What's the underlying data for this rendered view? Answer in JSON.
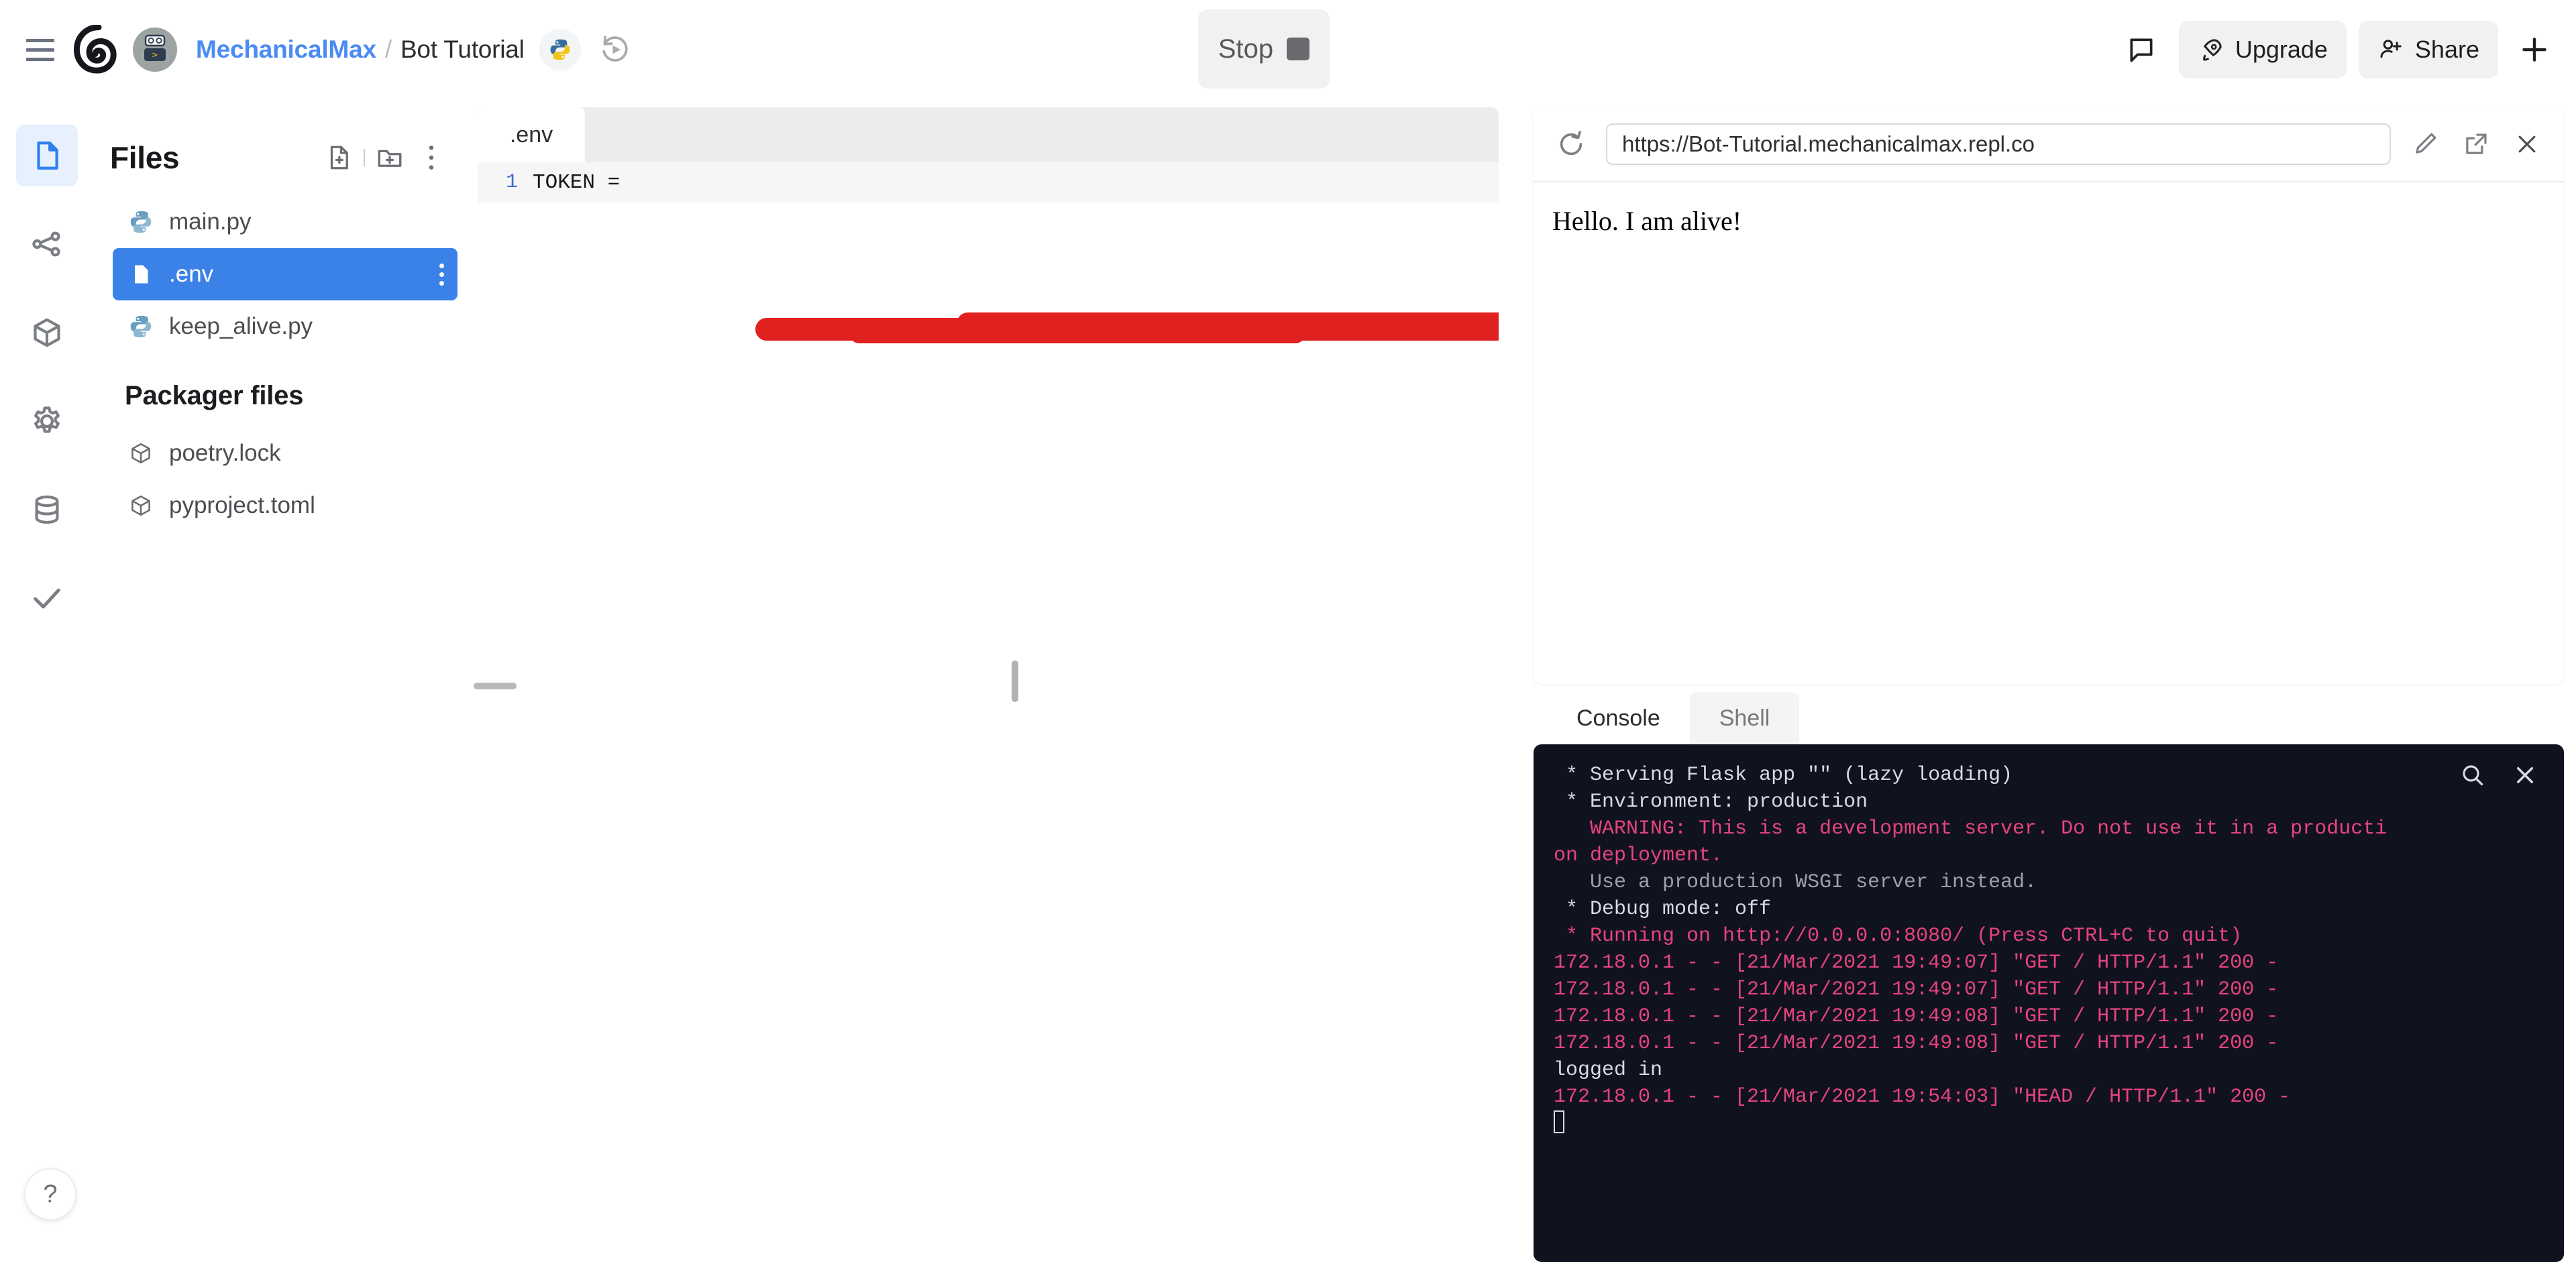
{
  "header": {
    "menu_icon": "hamburger-icon",
    "logo_icon": "replit-logo",
    "avatar_icon": "bot-avatar",
    "breadcrumb": {
      "owner": "MechanicalMax",
      "separator": "/",
      "repl": "Bot Tutorial"
    },
    "language_icon": "python-icon",
    "history_icon": "history-icon",
    "run_stop": {
      "label": "Stop",
      "icon": "stop-square-icon"
    },
    "chat_icon": "chat-bubble-icon",
    "upgrade": {
      "label": "Upgrade",
      "icon": "rocket-icon"
    },
    "share": {
      "label": "Share",
      "icon": "person-add-icon"
    },
    "plus_icon": "plus-icon",
    "accent_color": "#4b8bf4"
  },
  "rail": {
    "items": [
      {
        "name": "files",
        "icon": "file-icon",
        "active": true
      },
      {
        "name": "version-control",
        "icon": "git-branch-icon",
        "active": false
      },
      {
        "name": "packages",
        "icon": "package-box-icon",
        "active": false
      },
      {
        "name": "settings",
        "icon": "gear-icon",
        "active": false
      },
      {
        "name": "database",
        "icon": "database-icon",
        "active": false
      },
      {
        "name": "checks",
        "icon": "checkmark-icon",
        "active": false
      }
    ],
    "help_label": "?"
  },
  "files_panel": {
    "title": "Files",
    "actions": [
      {
        "name": "new-file",
        "icon": "file-plus-icon"
      },
      {
        "name": "new-folder",
        "icon": "folder-plus-icon"
      },
      {
        "name": "more-options",
        "icon": "kebab-menu-icon"
      }
    ],
    "files": [
      {
        "name": "main.py",
        "icon": "python-file-icon",
        "selected": false
      },
      {
        "name": ".env",
        "icon": "plain-file-icon",
        "selected": true
      },
      {
        "name": "keep_alive.py",
        "icon": "python-file-icon",
        "selected": false
      }
    ],
    "packager_section": "Packager files",
    "packager_files": [
      {
        "name": "poetry.lock",
        "icon": "package-box-icon"
      },
      {
        "name": "pyproject.toml",
        "icon": "package-box-icon"
      }
    ]
  },
  "editor": {
    "tabs": [
      {
        "label": ".env",
        "active": true
      }
    ],
    "lines": [
      {
        "number": "1",
        "text": "TOKEN = ",
        "redacted": true
      }
    ],
    "redaction_color": "#e12020"
  },
  "preview": {
    "reload_icon": "reload-icon",
    "url": "https://Bot-Tutorial.mechanicalmax.repl.co",
    "url_placeholder": "https://",
    "edit_icon": "pencil-icon",
    "open_external_icon": "external-link-icon",
    "close_icon": "close-x-icon",
    "body_text": "Hello. I am alive!"
  },
  "console": {
    "tabs": [
      {
        "label": "Console",
        "active": true
      },
      {
        "label": "Shell",
        "active": false
      }
    ],
    "tools": [
      {
        "name": "console-search",
        "icon": "search-icon"
      },
      {
        "name": "console-close",
        "icon": "close-x-icon"
      }
    ],
    "colors": {
      "white": "#d7dae0",
      "pink": "#e5447e",
      "grey": "#9ba0ab"
    },
    "lines": [
      {
        "color": "white",
        "text": " * Serving Flask app \"\" (lazy loading)"
      },
      {
        "color": "white",
        "text": " * Environment: production"
      },
      {
        "color": "pink",
        "text": "   WARNING: This is a development server. Do not use it in a producti\non deployment."
      },
      {
        "color": "grey",
        "text": "   Use a production WSGI server instead."
      },
      {
        "color": "white",
        "text": " * Debug mode: off"
      },
      {
        "color": "pink",
        "text": " * Running on http://0.0.0.0:8080/ (Press CTRL+C to quit)"
      },
      {
        "color": "pink",
        "text": "172.18.0.1 - - [21/Mar/2021 19:49:07] \"GET / HTTP/1.1\" 200 -"
      },
      {
        "color": "pink",
        "text": "172.18.0.1 - - [21/Mar/2021 19:49:07] \"GET / HTTP/1.1\" 200 -"
      },
      {
        "color": "pink",
        "text": "172.18.0.1 - - [21/Mar/2021 19:49:08] \"GET / HTTP/1.1\" 200 -"
      },
      {
        "color": "pink",
        "text": "172.18.0.1 - - [21/Mar/2021 19:49:08] \"GET / HTTP/1.1\" 200 -"
      },
      {
        "color": "white",
        "text": "logged in"
      },
      {
        "color": "pink",
        "text": "172.18.0.1 - - [21/Mar/2021 19:54:03] \"HEAD / HTTP/1.1\" 200 -"
      }
    ]
  }
}
